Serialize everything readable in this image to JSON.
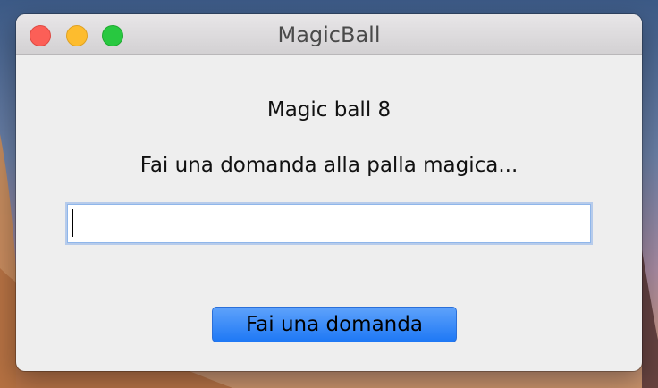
{
  "window": {
    "title": "MagicBall"
  },
  "main": {
    "heading": "Magic ball 8",
    "prompt": "Fai una domanda alla palla magica...",
    "question_input": {
      "value": "",
      "placeholder": ""
    },
    "ask_button_label": "Fai una domanda"
  },
  "colors": {
    "button_accent": "#1e78f5",
    "window_background": "#eeeeee"
  }
}
